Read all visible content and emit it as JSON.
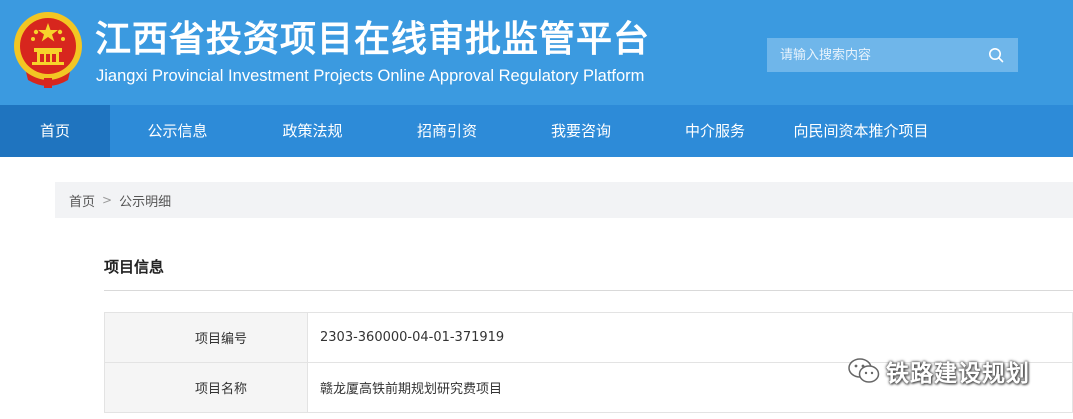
{
  "header": {
    "title": "江西省投资项目在线审批监管平台",
    "subtitle": "Jiangxi Provincial Investment Projects Online Approval Regulatory Platform",
    "emblem_icon": "national-emblem-icon",
    "search_placeholder": "请输入搜索内容",
    "search_icon": "search-icon",
    "bg_color": "#3b9ae0"
  },
  "nav": {
    "items": [
      {
        "label": "首页",
        "active": true
      },
      {
        "label": "公示信息"
      },
      {
        "label": "政策法规"
      },
      {
        "label": "招商引资"
      },
      {
        "label": "我要咨询"
      },
      {
        "label": "中介服务"
      },
      {
        "label": "向民间资本推介项目"
      }
    ],
    "bg_color": "#2d8bd8",
    "active_color": "#1f74bf"
  },
  "breadcrumb": {
    "home": "首页",
    "separator": ">",
    "current": "公示明细"
  },
  "section": {
    "title": "项目信息"
  },
  "info_table": {
    "rows": [
      {
        "label": "项目编号",
        "value": "2303-360000-04-01-371919"
      },
      {
        "label": "项目名称",
        "value": "赣龙厦高铁前期规划研究费项目"
      }
    ]
  },
  "watermark": {
    "icon": "wechat-icon",
    "text": "铁路建设规划"
  }
}
